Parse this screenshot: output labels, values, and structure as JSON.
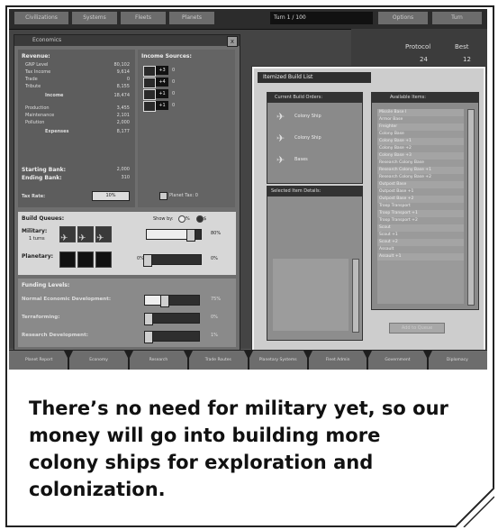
{
  "topbar": {
    "turn_text": "Turn 1 / 100",
    "buttons": [
      "Civilizations",
      "Systems",
      "Fleets",
      "Planets",
      "Options",
      "Turn"
    ]
  },
  "right_info": {
    "label_1": "Protocol",
    "label_2": "Best",
    "value_1": "24",
    "value_2": "12"
  },
  "econ": {
    "title": "Economics",
    "close": "x",
    "revenue_header": "Revenue:",
    "revenue_rows": [
      {
        "label": "GNP Level",
        "value": "80,102"
      },
      {
        "label": "Tax Income",
        "value": "9,614"
      },
      {
        "label": "Trade",
        "value": "0"
      },
      {
        "label": "Tribute",
        "value": "8,155"
      },
      {
        "label": "Income",
        "value": "18,474"
      },
      {
        "label": "Production",
        "value": "3,455"
      },
      {
        "label": "Maintenance",
        "value": "2,101"
      },
      {
        "label": "Pollution",
        "value": "2,000"
      },
      {
        "label": "Expenses",
        "value": "8,177"
      }
    ],
    "starting_bank": "Starting Bank:",
    "starting_bank_value": "2,000",
    "ending_bank": "Ending Bank:",
    "ending_bank_value": "310",
    "tax_rate_label": "Tax Rate:",
    "tax_rate_value": "10%",
    "income_sources_header": "Income Sources:",
    "income_sources": [
      {
        "label": "+3",
        "value": "0"
      },
      {
        "label": "+4",
        "value": "0"
      },
      {
        "label": "+1",
        "value": "0"
      },
      {
        "label": "+1",
        "value": "0"
      }
    ],
    "planet_tax_label": "Planet Tax: 0",
    "build_header": "Build Queues:",
    "show_by_label": "Show by:",
    "show_by_opt1": "%",
    "show_by_opt2": "$",
    "military_label": "Military:",
    "military_sub": "1 turns",
    "military_pct": "80%",
    "planetary_label": "Planetary:",
    "planetary_left": "0%",
    "planetary_pct": "0%",
    "planetary_fill": 0,
    "military_fill": 0.8,
    "funding_header": "Funding Levels:",
    "funding": [
      {
        "label": "Normal Economic Development:",
        "value": "75%",
        "fill": 0.35
      },
      {
        "label": "Terraforming:",
        "value": "0%",
        "fill": 0.05
      },
      {
        "label": "Research Development:",
        "value": "1%",
        "fill": 0.05
      }
    ]
  },
  "build_list": {
    "title": "Itemized Build List",
    "current_orders_header": "Current Build Orders:",
    "current_orders": [
      "Colony Ship",
      "Colony Ship",
      "Bases"
    ],
    "selected_details_header": "Selected Item Details:",
    "available_header": "Available Items:",
    "available_items": [
      "Missile Base I",
      "Armor Base",
      "Freighter",
      "Colony Base",
      "Colony Base +1",
      "Colony Base +2",
      "Colony Base +3",
      "Research Colony Base",
      "Research Colony Base +1",
      "Research Colony Base +2",
      "Outpost Base",
      "Outpost Base +1",
      "Outpost Base +2",
      "Troop Transport",
      "Troop Transport +1",
      "Troop Transport +2",
      "Scout",
      "Scout +1",
      "Scout +2",
      "Assault",
      "Assault +1"
    ],
    "add_button": "Add to Queue"
  },
  "tabs": [
    "Planet Report",
    "Economy",
    "Research",
    "Trade Routes",
    "Planetary Systems",
    "Fleet Admin",
    "Government",
    "Diplomacy"
  ],
  "caption": "There’s no need for military yet, so our money will go into building more colony ships for exploration and colonization."
}
